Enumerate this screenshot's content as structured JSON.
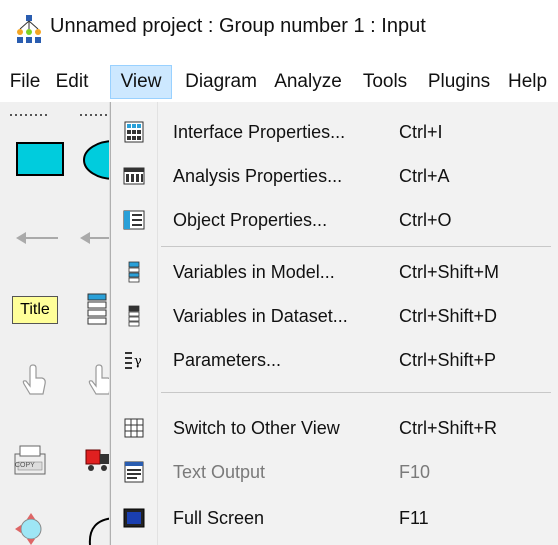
{
  "window": {
    "title": "Unnamed project : Group number 1 : Input"
  },
  "menubar": {
    "items": [
      {
        "label": "File"
      },
      {
        "label": "Edit"
      },
      {
        "label": "View"
      },
      {
        "label": "Diagram"
      },
      {
        "label": "Analyze"
      },
      {
        "label": "Tools"
      },
      {
        "label": "Plugins"
      },
      {
        "label": "Help"
      }
    ],
    "active": "View"
  },
  "palette": {
    "title_tool_label": "Title",
    "copy_tool_label": "COPY"
  },
  "view_menu": {
    "items": [
      {
        "label": "Interface Properties...",
        "shortcut": "Ctrl+I",
        "icon": "interface-properties-icon",
        "enabled": true
      },
      {
        "label": "Analysis Properties...",
        "shortcut": "Ctrl+A",
        "icon": "analysis-properties-icon",
        "enabled": true
      },
      {
        "label": "Object Properties...",
        "shortcut": "Ctrl+O",
        "icon": "object-properties-icon",
        "enabled": true
      },
      {
        "label": "Variables in Model...",
        "shortcut": "Ctrl+Shift+M",
        "icon": "variables-in-model-icon",
        "enabled": true
      },
      {
        "label": "Variables in Dataset...",
        "shortcut": "Ctrl+Shift+D",
        "icon": "variables-in-dataset-icon",
        "enabled": true
      },
      {
        "label": "Parameters...",
        "shortcut": "Ctrl+Shift+P",
        "icon": "parameters-icon",
        "enabled": true
      },
      {
        "label": "Switch to Other View",
        "shortcut": "Ctrl+Shift+R",
        "icon": "switch-view-icon",
        "enabled": true
      },
      {
        "label": "Text Output",
        "shortcut": "F10",
        "icon": "text-output-icon",
        "enabled": false
      },
      {
        "label": "Full Screen",
        "shortcut": "F11",
        "icon": "full-screen-icon",
        "enabled": true
      }
    ]
  },
  "colors": {
    "menu_highlight": "#cde8ff",
    "menu_highlight_border": "#99d1ff",
    "rect_tool": "#00ccdd",
    "title_tool": "#ffff99"
  }
}
